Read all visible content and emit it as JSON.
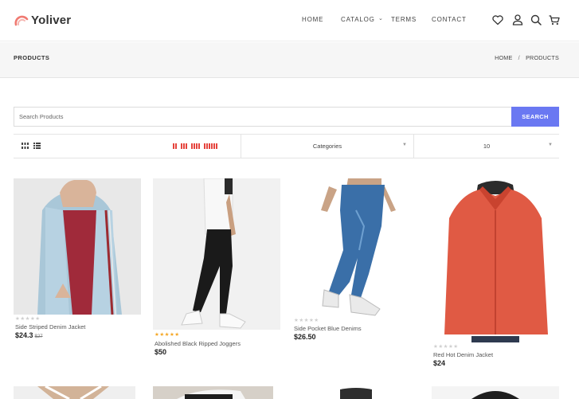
{
  "header": {
    "brand": "Yoliver",
    "nav": [
      {
        "label": "HOME"
      },
      {
        "label": "CATALOG"
      },
      {
        "label": "TERMS"
      },
      {
        "label": "CONTACT"
      }
    ],
    "icons": [
      "heart-icon",
      "user-icon",
      "search-icon",
      "cart-icon"
    ]
  },
  "breadcrumb": {
    "title": "PRODUCTS",
    "path": [
      "HOME",
      "/",
      "PRODUCTS"
    ]
  },
  "search": {
    "placeholder": "Search Products",
    "button_label": "SEARCH"
  },
  "toolbar": {
    "category_select": "Categories",
    "per_page_select": "10"
  },
  "products": [
    {
      "name": "Side Striped Denim Jacket",
      "price": "$24.3",
      "old_price": "$27",
      "rating": 0
    },
    {
      "name": "Abolished Black Ripped Joggers",
      "price": "$50",
      "old_price": "",
      "rating": 5
    },
    {
      "name": "Side Pocket Blue Denims",
      "price": "$26.50",
      "old_price": "",
      "rating": 0
    },
    {
      "name": "Red Hot Denim Jacket",
      "price": "$24",
      "old_price": "",
      "rating": 0
    }
  ],
  "colors": {
    "accent": "#6a78f2",
    "grid_icons": "#e5443d",
    "rating_filled": "#f5a623",
    "rating_empty": "#cfcfcf"
  }
}
